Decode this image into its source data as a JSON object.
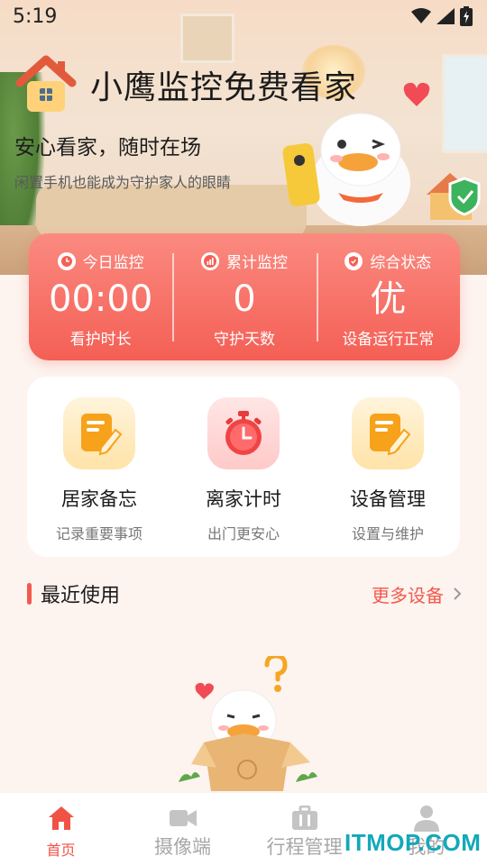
{
  "status_bar": {
    "time": "5:19"
  },
  "header": {
    "app_title": "小鹰监控免费看家",
    "slogan": "安心看家，随时在场",
    "subslogan": "闲置手机也能成为守护家人的眼睛"
  },
  "stats": [
    {
      "icon": "clock-icon",
      "head": "今日监控",
      "value": "00:00",
      "label": "看护时长"
    },
    {
      "icon": "bar-chart-icon",
      "head": "累计监控",
      "value": "0",
      "label": "守护天数"
    },
    {
      "icon": "shield-check-icon",
      "head": "综合状态",
      "value": "优",
      "label": "设备运行正常"
    }
  ],
  "features": [
    {
      "icon": "memo-pencil-icon",
      "title": "居家备忘",
      "subtitle": "记录重要事项"
    },
    {
      "icon": "stopwatch-icon",
      "title": "离家计时",
      "subtitle": "出门更安心"
    },
    {
      "icon": "memo-pencil-icon",
      "title": "设备管理",
      "subtitle": "设置与维护"
    }
  ],
  "recent": {
    "title": "最近使用",
    "more_label": "更多设备"
  },
  "tabs": [
    {
      "icon": "home-icon",
      "label": "首页",
      "active": true
    },
    {
      "icon": "video-camera-icon",
      "label": "摄像端",
      "active": false
    },
    {
      "icon": "briefcase-icon",
      "label": "行程管理",
      "active": false
    },
    {
      "icon": "user-icon",
      "label": "我的",
      "active": false
    }
  ],
  "watermark": "ITMOP.COM",
  "colors": {
    "accent": "#f25a4f",
    "card_gradient_top": "#fb8a80",
    "card_gradient_bottom": "#f45f55",
    "page_background": "#fdf3ef",
    "watermark": "#13a8bb"
  }
}
